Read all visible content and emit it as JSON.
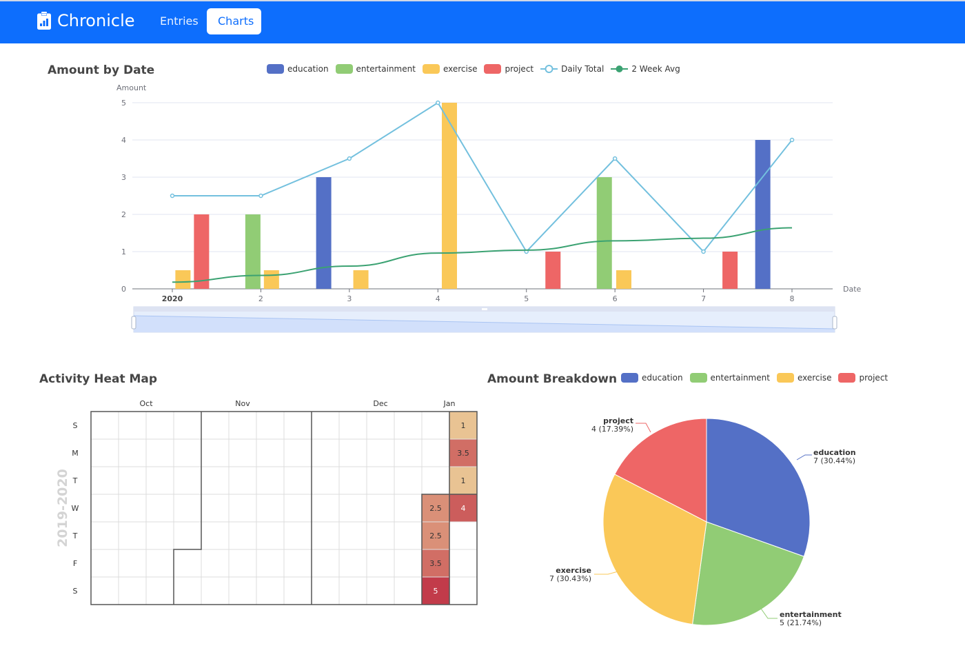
{
  "navbar": {
    "brand": "Chronicle",
    "brand_icon": "clipboard-chart-icon",
    "links": [
      {
        "label": "Entries",
        "active": false
      },
      {
        "label": "Charts",
        "active": true
      }
    ],
    "color": "#0d6efd"
  },
  "colors": {
    "education": "#5470c6",
    "entertainment": "#91cc75",
    "exercise": "#fac858",
    "project": "#ee6666",
    "daily_total": "#73c0de",
    "two_week_avg": "#3ba272"
  },
  "chart_data": [
    {
      "id": "amount-by-date",
      "type": "bar",
      "title": "Amount by Date",
      "xlabel": "Date",
      "ylabel": "Amount",
      "ylim": [
        0,
        5
      ],
      "yticks": [
        "0",
        "1",
        "2",
        "3",
        "4",
        "5"
      ],
      "xticks": [
        "2020",
        "2",
        "3",
        "4",
        "5",
        "6",
        "7",
        "8"
      ],
      "legend": [
        "education",
        "entertainment",
        "exercise",
        "project",
        "Daily Total",
        "2 Week Avg"
      ],
      "legend_position": "top-center",
      "grid": true,
      "bars": [
        {
          "series": "exercise",
          "day": 1.12,
          "value": 0.5
        },
        {
          "series": "project",
          "day": 1.33,
          "value": 2
        },
        {
          "series": "entertainment",
          "day": 1.91,
          "value": 2
        },
        {
          "series": "exercise",
          "day": 2.12,
          "value": 0.5
        },
        {
          "series": "education",
          "day": 2.71,
          "value": 3
        },
        {
          "series": "exercise",
          "day": 3.13,
          "value": 0.5
        },
        {
          "series": "exercise",
          "day": 4.13,
          "value": 5
        },
        {
          "series": "project",
          "day": 5.3,
          "value": 1
        },
        {
          "series": "entertainment",
          "day": 5.88,
          "value": 3
        },
        {
          "series": "exercise",
          "day": 6.1,
          "value": 0.5
        },
        {
          "series": "project",
          "day": 7.3,
          "value": 1
        },
        {
          "series": "education",
          "day": 7.67,
          "value": 4
        }
      ],
      "lines": [
        {
          "name": "Daily Total",
          "symbol": "empty-circle",
          "x": [
            1,
            2,
            3,
            4,
            5,
            6,
            7,
            8
          ],
          "values": [
            2.5,
            2.5,
            3.5,
            5,
            1,
            3.5,
            1,
            4
          ]
        },
        {
          "name": "2 Week Avg",
          "symbol": "none",
          "smooth": true,
          "x": [
            1,
            2,
            3,
            4,
            5,
            6,
            7,
            8
          ],
          "values": [
            0.18,
            0.36,
            0.61,
            0.96,
            1.04,
            1.29,
            1.36,
            1.64
          ]
        }
      ],
      "data_zoom": {
        "start_percent": 0,
        "end_percent": 100
      }
    },
    {
      "id": "activity-heat-map",
      "type": "heatmap",
      "title": "Activity Heat Map",
      "range_label": "2019-2020",
      "month_labels": [
        "Oct",
        "Nov",
        "Dec",
        "Jan"
      ],
      "day_labels": [
        "S",
        "M",
        "T",
        "W",
        "T",
        "F",
        "S"
      ],
      "weeks": 14,
      "month_boundaries": [
        {
          "week": 4,
          "from_day": 0,
          "to_day": 5
        },
        {
          "week": 3,
          "from_day": 5,
          "to_day": 7
        },
        {
          "week": 8,
          "from_day": 0,
          "to_day": 7
        },
        {
          "week": 13,
          "from_day": 0,
          "to_day": 3
        },
        {
          "week": 12,
          "from_day": 3,
          "to_day": 7
        }
      ],
      "cells": [
        {
          "week": 12,
          "day": 3,
          "value": 2.5
        },
        {
          "week": 12,
          "day": 4,
          "value": 2.5
        },
        {
          "week": 12,
          "day": 5,
          "value": 3.5
        },
        {
          "week": 12,
          "day": 6,
          "value": 5
        },
        {
          "week": 13,
          "day": 0,
          "value": 1
        },
        {
          "week": 13,
          "day": 1,
          "value": 3.5
        },
        {
          "week": 13,
          "day": 2,
          "value": 1
        },
        {
          "week": 13,
          "day": 3,
          "value": 4
        }
      ],
      "value_range": [
        1,
        5
      ],
      "color_low": "#e9c393",
      "color_high": "#c23b4a"
    },
    {
      "id": "amount-breakdown",
      "type": "pie",
      "title": "Amount Breakdown",
      "legend": [
        "education",
        "entertainment",
        "exercise",
        "project"
      ],
      "legend_position": "top",
      "slices": [
        {
          "name": "education",
          "value": 7,
          "label": "7 (30.44%)"
        },
        {
          "name": "entertainment",
          "value": 5,
          "label": "5 (21.74%)"
        },
        {
          "name": "exercise",
          "value": 7,
          "label": "7 (30.43%)"
        },
        {
          "name": "project",
          "value": 4,
          "label": "4 (17.39%)"
        }
      ]
    }
  ]
}
